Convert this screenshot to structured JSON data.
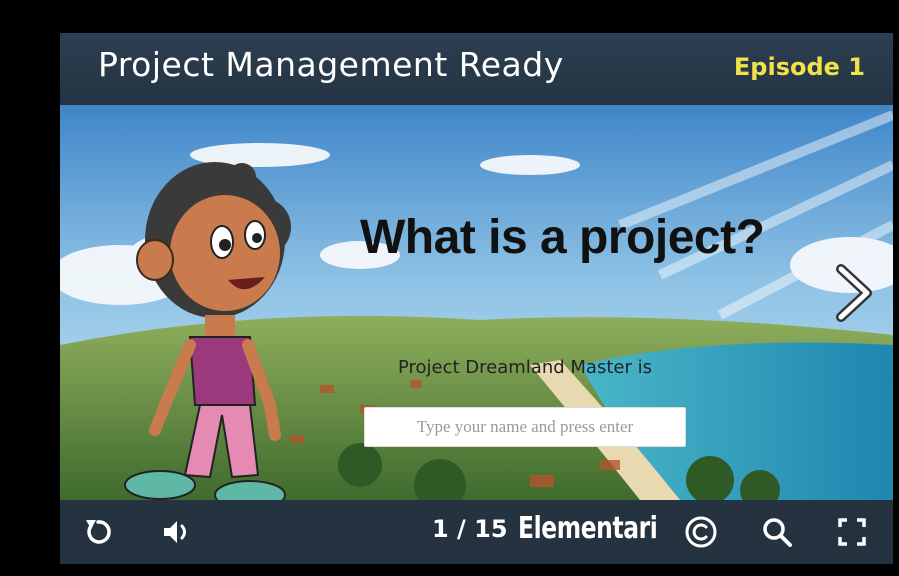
{
  "header": {
    "title": "Project Management Ready",
    "episode": "Episode 1"
  },
  "slide": {
    "question": "What is a project?",
    "prompt": "Project Dreamland Master is",
    "input_placeholder": "Type your name and press enter",
    "input_value": ""
  },
  "toolbar": {
    "counter": "1 / 15",
    "current_slide": 1,
    "total_slides": 15,
    "brand": "Elementari",
    "icons": [
      "replay-icon",
      "volume-icon",
      "copyright-icon",
      "search-icon",
      "fullscreen-icon"
    ]
  },
  "navigation": {
    "next_icon": "chevron-right-icon"
  },
  "colors": {
    "header_bg": "#2c3e50",
    "toolbar_bg": "#253240",
    "episode_text": "#f2e24a",
    "title_text": "#ffffff"
  }
}
